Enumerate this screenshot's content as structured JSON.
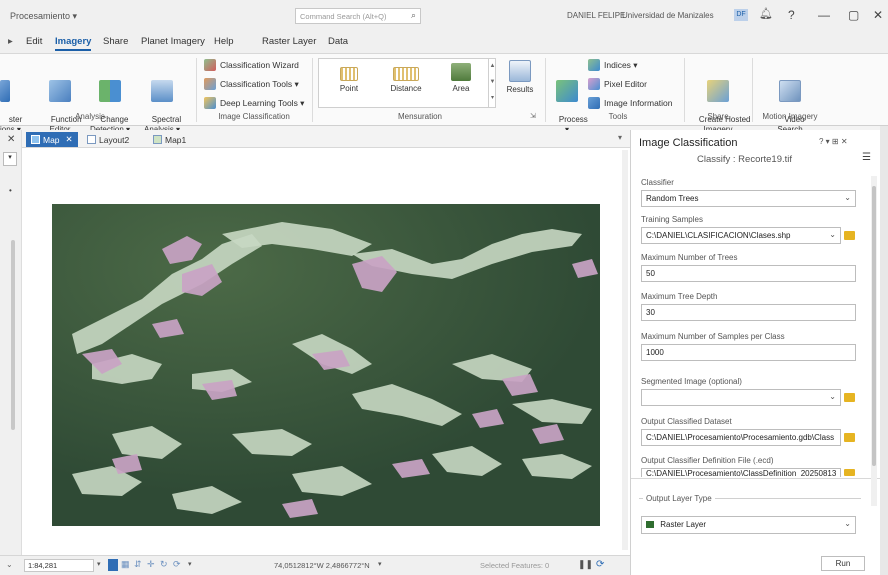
{
  "titlebar": {
    "project": "Procesamiento ▾",
    "search_placeholder": "Command Search (Alt+Q)",
    "user": "DANIEL FELIPE",
    "org": "Universidad de Manizales",
    "user_initials": "DF",
    "question": "?",
    "minimize": "—",
    "maximize": "▢",
    "close": "✕"
  },
  "tabs": {
    "edit": "Edit",
    "imagery": "Imagery",
    "share": "Share",
    "planet": "Planet Imagery",
    "help": "Help",
    "raster_layer": "Raster Layer",
    "data": "Data"
  },
  "ribbon": {
    "raster_functions_partial": "ster\nions ▾",
    "function_editor": "Function\nEditor",
    "change_detection": "Change\nDetection ▾",
    "spectral_analysis": "Spectral\nAnalysis ▾",
    "group_analysis": "Analysis",
    "classification_wizard": "Classification Wizard",
    "classification_tools": "Classification Tools ▾",
    "deep_learning_tools": "Deep Learning Tools ▾",
    "group_image_classification": "Image Classification",
    "point": "Point",
    "distance": "Distance",
    "area": "Area",
    "results": "Results",
    "group_mensuration": "Mensuration",
    "process": "Process\n▾",
    "indices": "Indices ▾",
    "pixel_editor": "Pixel Editor",
    "image_information": "Image Information",
    "group_tools": "Tools",
    "create_hosted_imagery": "Create Hosted\nImagery",
    "group_share": "Share",
    "video_search": "Video\nSearch",
    "group_motion": "Motion Imagery"
  },
  "map_tabs": {
    "map": "Map",
    "layout2": "Layout2",
    "map1": "Map1"
  },
  "statusbar": {
    "scale": "1:84,281",
    "coordinates": "74,0512812°W 2,4866772°N",
    "selected_features": "Selected Features: 0"
  },
  "panel": {
    "title": "Image Classification",
    "subtitle": "Classify : Recorte19.tif",
    "controls": "? ▾ ⊞ ✕",
    "classifier_label": "Classifier",
    "classifier_value": "Random Trees",
    "training_label": "Training Samples",
    "training_value": "C:\\DANIEL\\CLASIFICACION\\Clases.shp",
    "max_trees_label": "Maximum Number of Trees",
    "max_trees_value": "50",
    "max_depth_label": "Maximum Tree Depth",
    "max_depth_value": "30",
    "max_samples_label": "Maximum Number of Samples per Class",
    "max_samples_value": "1000",
    "segmented_label": "Segmented Image (optional)",
    "segmented_value": "",
    "output_dataset_label": "Output Classified Dataset",
    "output_dataset_value": "C:\\DANIEL\\Procesamiento\\Procesamiento.gdb\\Class",
    "output_def_label": "Output Classifier Definition File (.ecd)",
    "output_def_value": "C:\\DANIEL\\Procesamiento\\ClassDefinition_20250813",
    "output_layer_type_label": "Output Layer Type",
    "output_layer_type_value": "Raster Layer",
    "run": "Run"
  },
  "colors": {
    "accent": "#1b5fa8",
    "map_tab": "#2f6db5",
    "folder": "#e6b422",
    "forest": "#3f5a3f",
    "clearing": "#c9d8c4",
    "pink_patch": "#c9a3c4"
  }
}
